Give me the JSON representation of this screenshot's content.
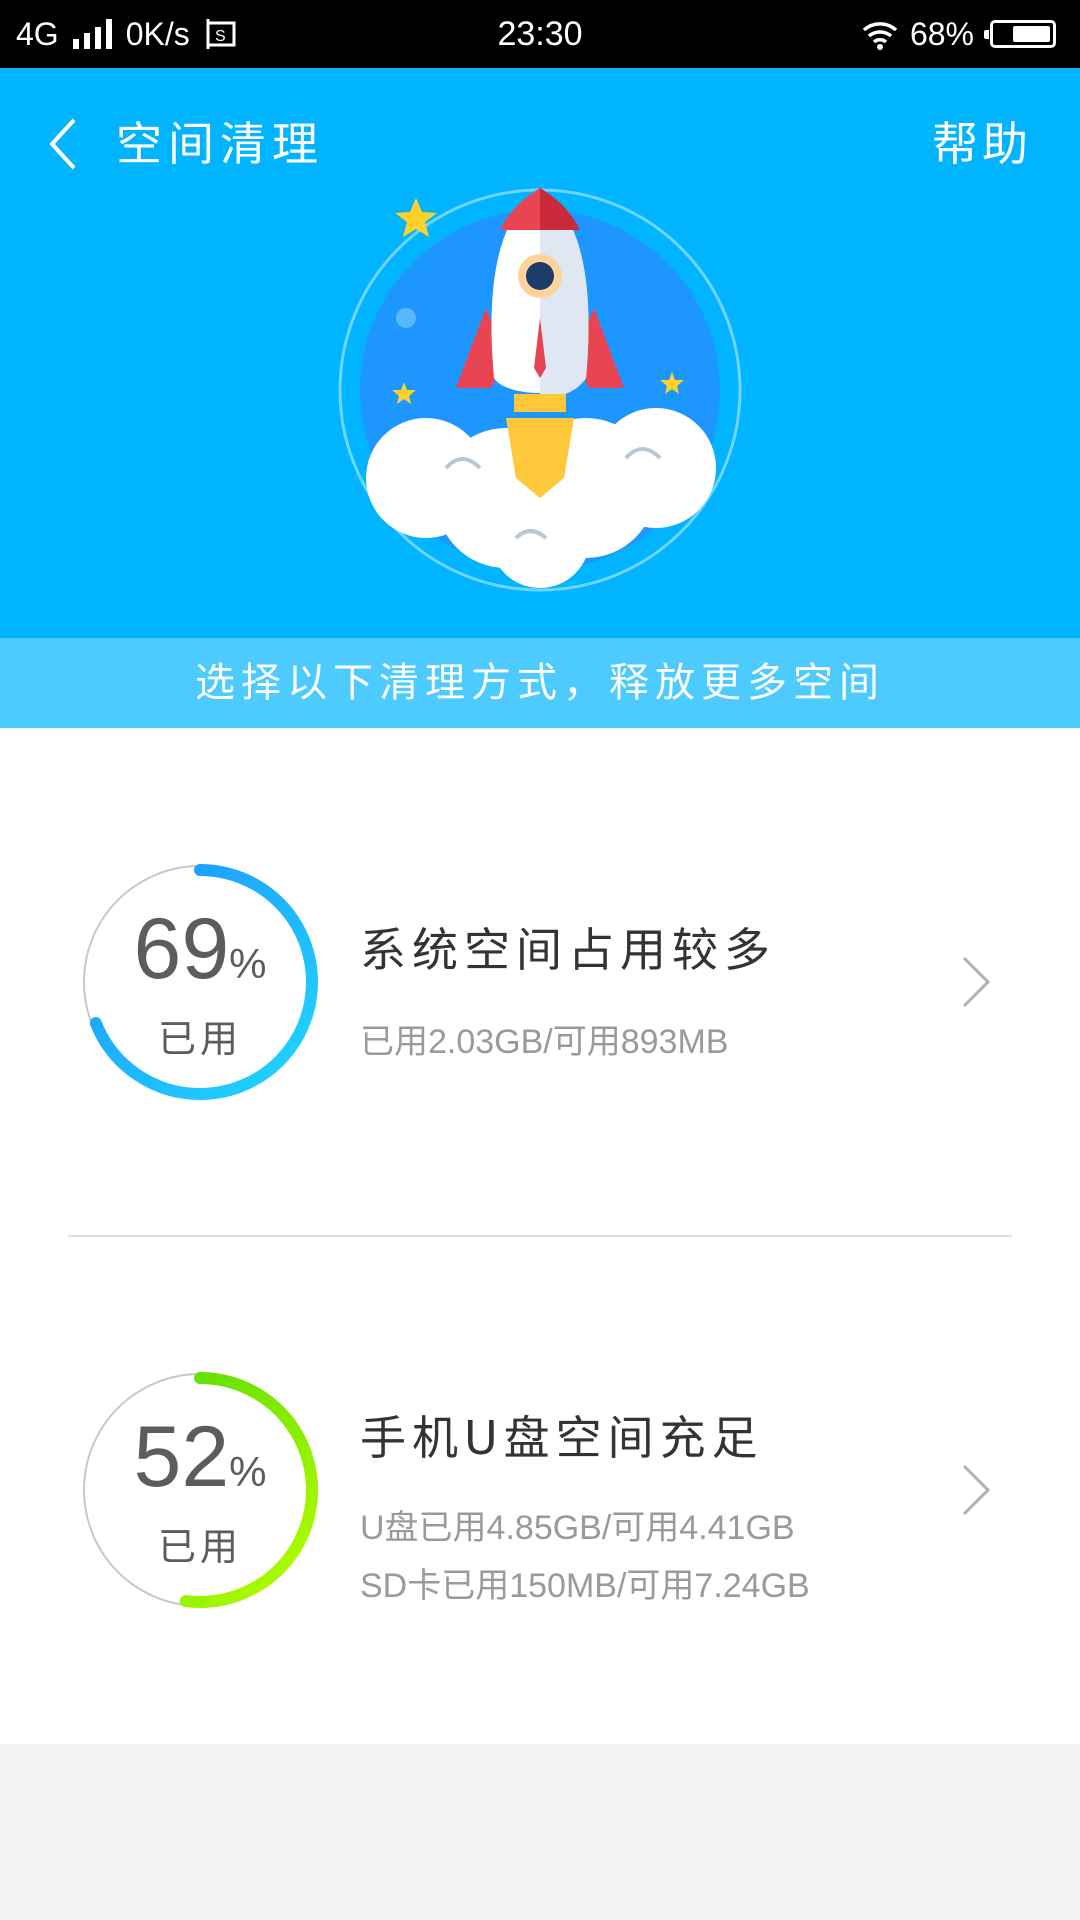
{
  "status_bar": {
    "network": "4G",
    "speed": "0K/s",
    "time": "23:30",
    "battery_text": "68%",
    "battery_level": 0.68,
    "icons": [
      "signal-icon",
      "screenshot-icon",
      "wifi-icon",
      "battery-icon"
    ]
  },
  "header": {
    "title": "空间清理",
    "help": "帮助",
    "back_icon": "chevron-left-icon",
    "illustration": "rocket-launch",
    "background": "#00b4ff"
  },
  "subtitle": "选择以下清理方式，释放更多空间",
  "items": [
    {
      "percent": "69",
      "percent_value": 0.69,
      "percent_sign": "%",
      "used_label": "已用",
      "title": "系统空间占用较多",
      "details": [
        "已用2.03GB/可用893MB"
      ],
      "ring_colors": [
        "#1fd8ff",
        "#1e90ff"
      ]
    },
    {
      "percent": "52",
      "percent_value": 0.52,
      "percent_sign": "%",
      "used_label": "已用",
      "title": "手机U盘空间充足",
      "details": [
        "U盘已用4.85GB/可用4.41GB",
        "SD卡已用150MB/可用7.24GB"
      ],
      "ring_colors": [
        "#b6ff00",
        "#4cd600"
      ]
    }
  ]
}
